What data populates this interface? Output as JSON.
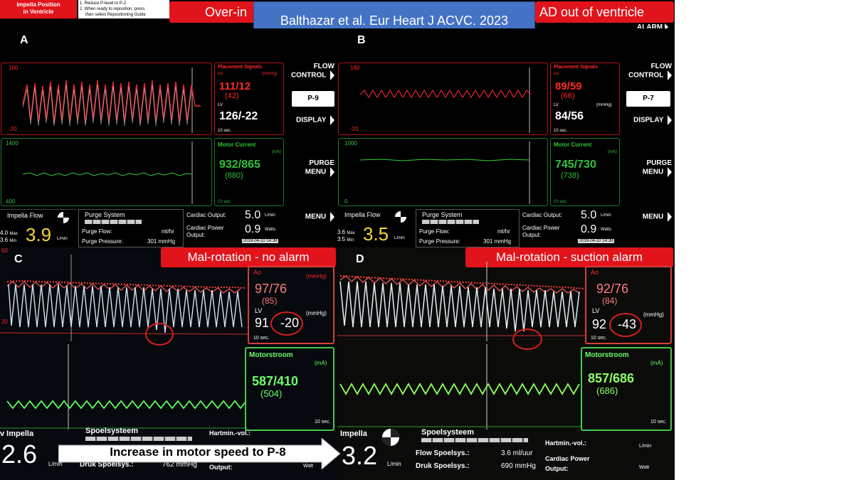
{
  "header": {
    "impella_position": "Impella Position\nin Ventricle",
    "instruction_lines": [
      "1. Reduce P-level to P-2",
      "2. When ready to reposition, press",
      "then select Repositioning Guide"
    ],
    "banner_left": "Over-in",
    "banner_right": "AD out of ventricle",
    "citation": "Balthazar et al. Eur Heart J ACVC. 2023",
    "alarm": "ALARM"
  },
  "panel_a": {
    "letter": "A",
    "placement_title": "Placement Signals",
    "ao_label": "Ao",
    "unit_mmhg": "(mmHg)",
    "ao_value": "111/12",
    "ao_mean": "(42)",
    "lv_label": "LV",
    "lv_value": "126/-22",
    "ten_sec": "10 sec.",
    "scale_top": "160",
    "scale_bottom": "-20",
    "motor_title": "Motor Current",
    "motor_unit": "(mA)",
    "motor_value": "932/865",
    "motor_mean": "(880)",
    "motor_scale_top": "1400",
    "motor_scale_bottom": "400",
    "flow_control": [
      "FLOW",
      "CONTROL"
    ],
    "p_level": "P-9",
    "display": "DISPLAY",
    "purge_menu": [
      "PURGE",
      "MENU"
    ],
    "menu": "MENU",
    "impella_flow": "Impella Flow",
    "flow_max": "4.0",
    "flow_min": "3.6",
    "max_label": "Max",
    "min_label": "Min",
    "flow_value": "3.9",
    "flow_unit": "L/min",
    "purge_system": "Purge System",
    "purge_flow": "Purge Flow:",
    "purge_flow_unit": "ml/hr",
    "purge_pressure": "Purge Pressure:",
    "purge_pressure_value": "301 mmHg",
    "cardiac_output": "Cardiac Output:",
    "co_value": "5.0",
    "co_unit": "L/min",
    "cardiac_power": "Cardiac Power Output:",
    "cp_value": "0.9",
    "cp_unit": "Watts",
    "timestamp": "2019-04-10 14:39"
  },
  "panel_b": {
    "letter": "B",
    "ao_value": "89/59",
    "ao_mean": "(66)",
    "lv_value": "84/56",
    "scale_top": "160",
    "scale_bottom": "-20",
    "motor_value": "745/730",
    "motor_mean": "(738)",
    "motor_scale_top": "1000",
    "motor_scale_bottom": "0",
    "p_level": "P-7",
    "flow_max": "3.6",
    "flow_min": "3.5",
    "flow_value": "3.5",
    "purge_pressure_value": "301 mmHg",
    "co_value": "5.0",
    "cp_value": "0.9",
    "timestamp": "2019-04-10 14:39"
  },
  "panel_c": {
    "letter": "C",
    "banner": "Mal-rotation - no alarm",
    "ao_label": "Ao",
    "unit_mmhg": "(mmHg)",
    "ao_value": "97/76",
    "ao_mean": "(85)",
    "lv_label": "LV",
    "lv_sys": "91",
    "lv_dia": "-20",
    "ten_sec": "10 sec.",
    "scale_top": "60",
    "scale_left": "20",
    "motor_title": "Motorstroom",
    "motor_unit": "(mA)",
    "motor_value": "587/410",
    "motor_mean": "(504)",
    "impella": "v Impella",
    "flow_value": "2.6",
    "flow_unit": "L/min",
    "purge_system": "Spoelsysteem",
    "hartmin": "Hartmin.-vol.:",
    "druk": "Druk Spoelsys.:",
    "druk_value": "762 mmHg",
    "output": "Output:",
    "watt": "Watt"
  },
  "panel_d": {
    "letter": "D",
    "banner": "Mal-rotation - suction alarm",
    "ao_label": "Ao",
    "ao_value": "92/76",
    "ao_mean": "(84)",
    "lv_label": "LV",
    "lv_sys": "92",
    "lv_dia": "-43",
    "unit_mmhg": "(mmHg)",
    "ten_sec": "10 sec.",
    "motor_title": "Motorstroom",
    "motor_unit": "(mA)",
    "motor_value": "857/686",
    "motor_mean": "(686)",
    "impella": "Impella",
    "flow_value": "3.2",
    "flow_unit": "L/min",
    "purge_system": "Spoelsysteem",
    "flow_spoel": "Flow Spoelsys.:",
    "flow_spoel_value": "3.6 ml/uur",
    "druk": "Druk Spoelsys.:",
    "druk_value": "690 mmHg",
    "hartmin": "Hartmin.-vol.:",
    "cardiac_power": "Cardiac Power",
    "output": "Output:",
    "lmin": "L/min",
    "watt": "Watt"
  },
  "arrow_caption": "Increase in motor speed to P-8",
  "colors": {
    "banner_red": "#e1141b",
    "citation_blue": "#4472c4",
    "waveform_red": "#e8262d",
    "waveform_green": "#2fd33a"
  }
}
